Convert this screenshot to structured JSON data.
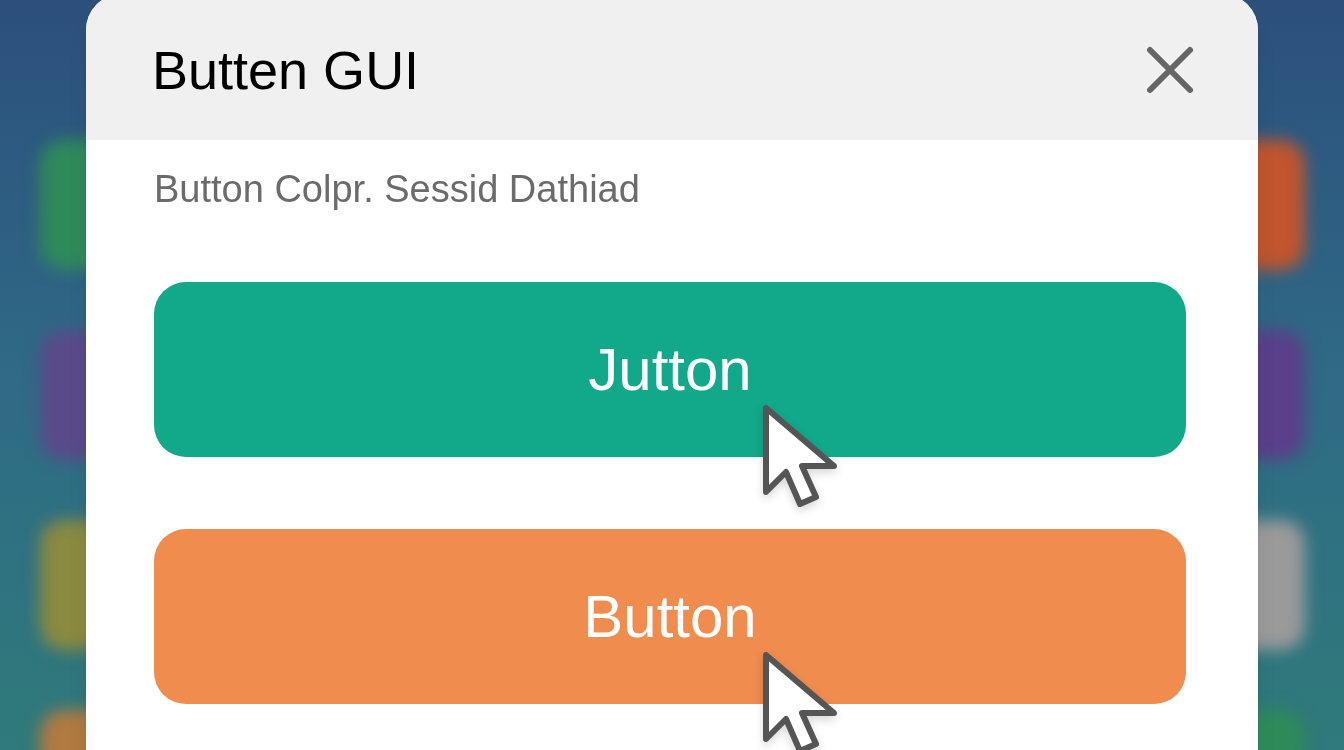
{
  "dialog": {
    "title": "Butten GUI",
    "subtitle": "Button Colpr. Sessid Dathiad"
  },
  "buttons": [
    {
      "label": "Jutton",
      "color": "#12a88a",
      "hovered": true
    },
    {
      "label": "Button",
      "color": "#f08c4e",
      "hovered": true
    }
  ]
}
